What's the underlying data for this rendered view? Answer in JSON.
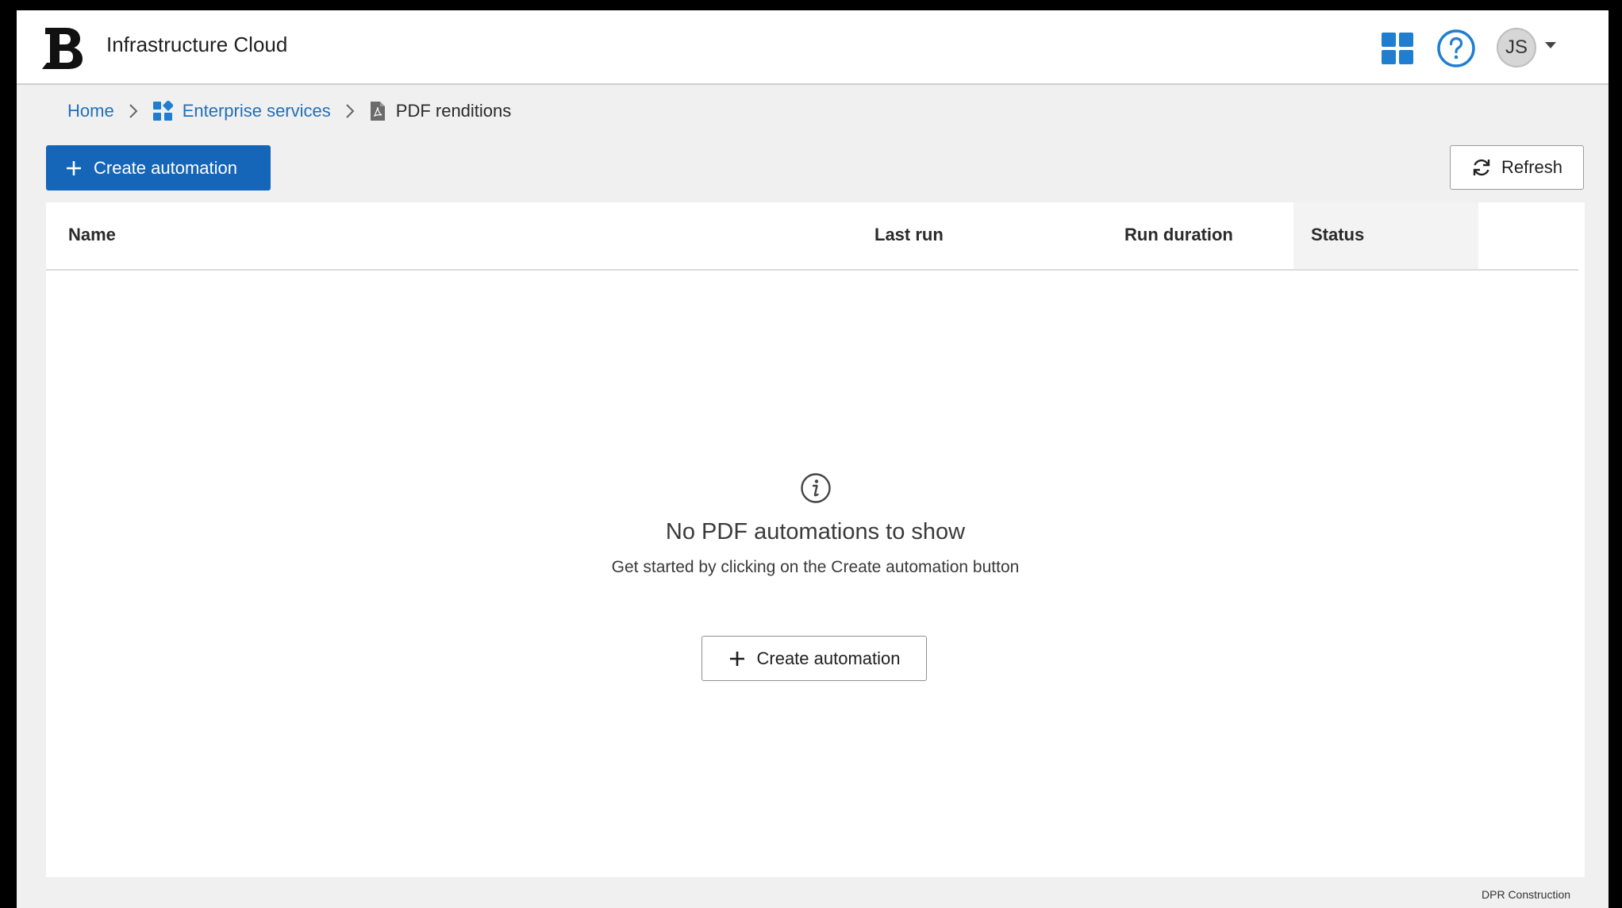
{
  "header": {
    "logo_letter": "B",
    "app_title": "Infrastructure Cloud",
    "avatar_initials": "JS",
    "accent_color": "#1f7ed0"
  },
  "breadcrumb": {
    "home": "Home",
    "enterprise": "Enterprise services",
    "current": "PDF renditions"
  },
  "toolbar": {
    "create_label": "Create automation",
    "refresh_label": "Refresh"
  },
  "table": {
    "columns": [
      "Name",
      "Last run",
      "Run duration",
      "Status"
    ]
  },
  "empty_state": {
    "title": "No PDF automations to show",
    "subtitle": "Get started by clicking on the Create automation button",
    "button_label": "Create automation"
  },
  "footer": {
    "organization": "DPR Construction"
  }
}
